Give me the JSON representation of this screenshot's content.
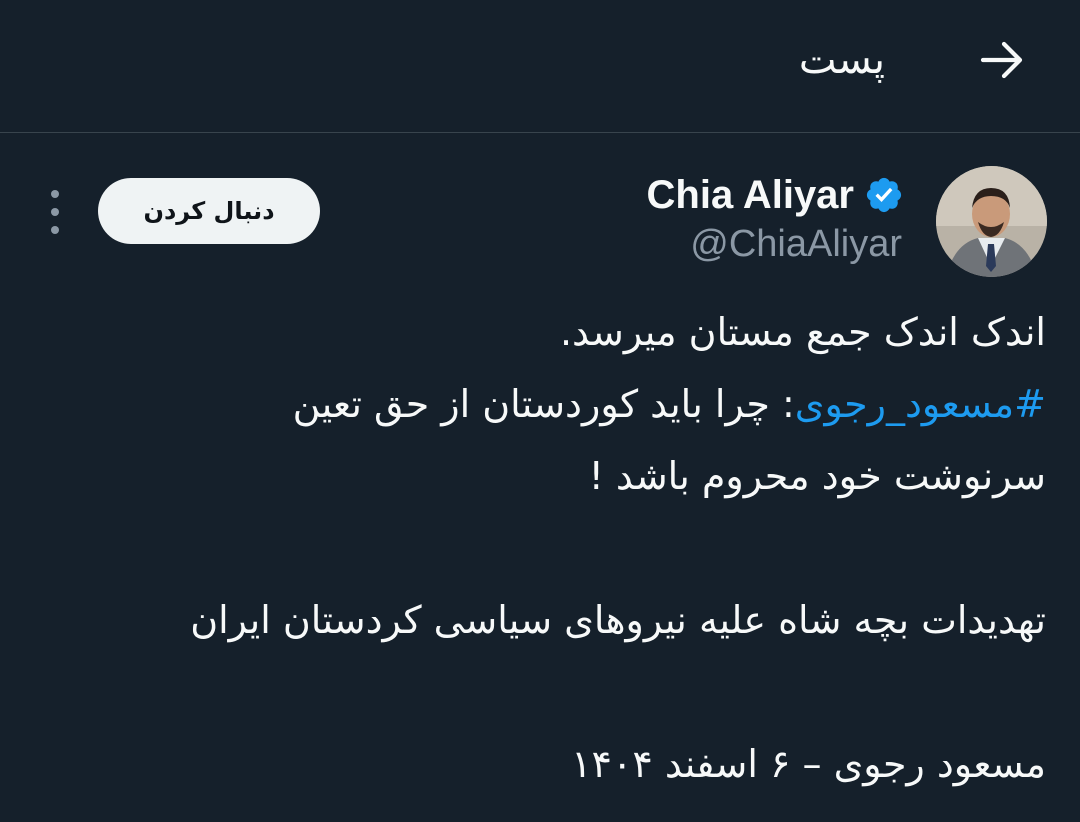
{
  "header": {
    "title": "پست"
  },
  "author": {
    "display_name": "Chia Aliyar",
    "handle": "@ChiaAliyar",
    "verified": true
  },
  "actions": {
    "follow_label": "دنبال کردن"
  },
  "tweet": {
    "line1": "اندک اندک جمع مستان میرسد.",
    "hashtag": "#مسعود_رجوی",
    "line2_rest": ": چرا باید کوردستان از حق تعین",
    "line3": "سرنوشت خود محروم باشد !",
    "line4": "تهدیدات بچه شاه علیه نیروهای سیاسی کردستان ایران",
    "line5": "مسعود رجوی – ۶ اسفند ۱۴۰۴"
  },
  "colors": {
    "background": "#15202b",
    "accent": "#1d9bf0",
    "secondary_text": "#8b98a5",
    "divider": "#38444d"
  },
  "icons": {
    "back": "arrow-right-icon",
    "verified": "verified-badge-icon",
    "more": "more-vertical-icon"
  }
}
